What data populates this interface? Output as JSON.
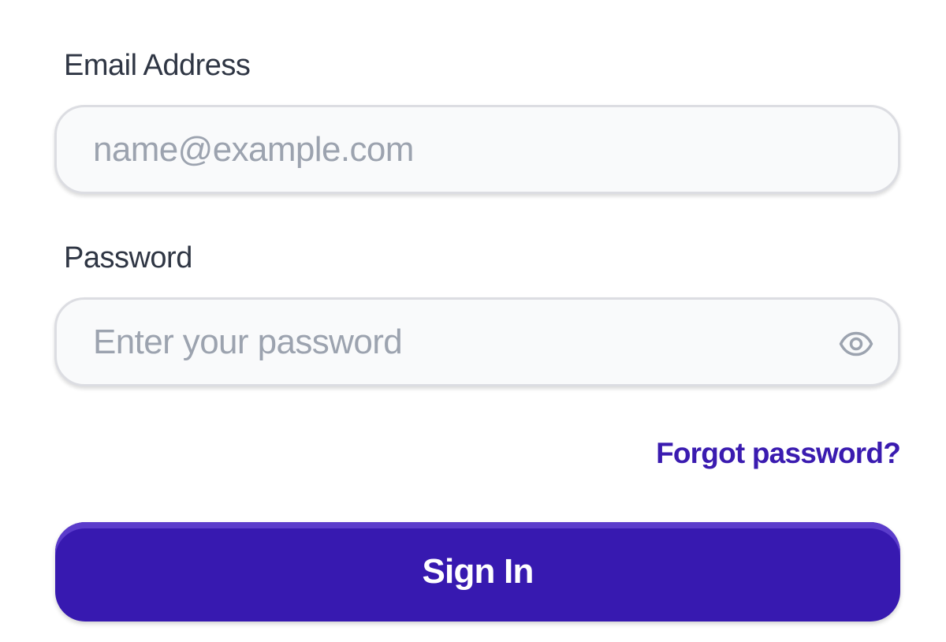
{
  "email": {
    "label": "Email Address",
    "value": "",
    "placeholder": "name@example.com"
  },
  "password": {
    "label": "Password",
    "value": "",
    "placeholder": "Enter your password",
    "toggle_icon": "eye-icon"
  },
  "forgot_password_label": "Forgot password?",
  "sign_in_label": "Sign In",
  "colors": {
    "accent": "#3719b0",
    "link": "#3a1bb0",
    "label_text": "#2f3644",
    "placeholder_text": "#9ca3af",
    "field_background": "#f9fafb",
    "field_border": "#dcdde2"
  }
}
